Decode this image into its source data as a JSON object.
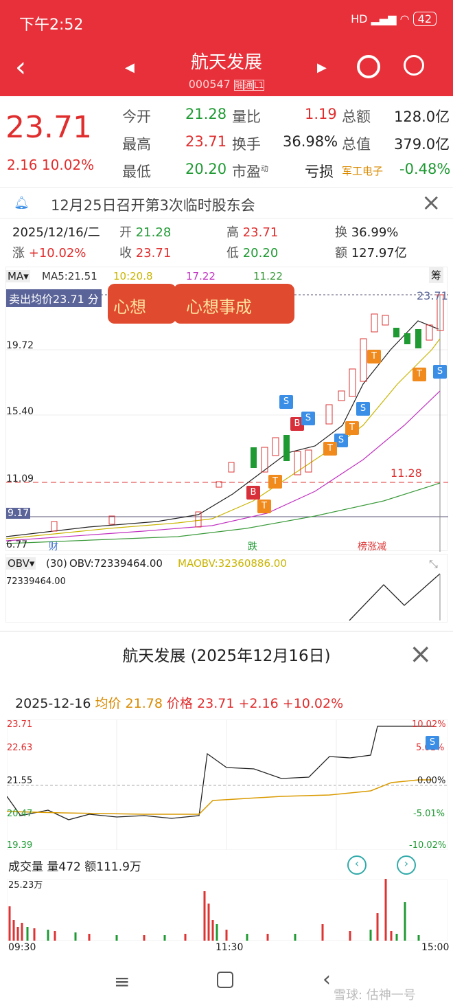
{
  "status": {
    "time": "下午2:52",
    "battery": "42",
    "signal": "HD"
  },
  "nav": {
    "title": "航天发展",
    "code": "000547",
    "tag1": "融",
    "tag2": "通",
    "tag3": "L1"
  },
  "quote": {
    "price": "23.71",
    "change": "2.16",
    "pct": "10.02%",
    "k1": "今开",
    "v1": "21.28",
    "k2": "量比",
    "v2": "1.19",
    "k3": "总额",
    "v3": "128.0亿",
    "k4": "最高",
    "v4": "23.71",
    "k5": "换手",
    "v5": "36.98%",
    "k6": "总值",
    "v6": "379.0亿",
    "k7": "最低",
    "v7": "20.20",
    "k8": "市盈",
    "k8sup": "动",
    "v8": "亏损",
    "k9": "军工电子",
    "v9": "-0.48%"
  },
  "notice": "12月25日召开第3次临时股东会",
  "day": {
    "date": "2025/12/16/二",
    "open_k": "开",
    "open": "21.28",
    "high_k": "高",
    "high": "23.71",
    "turn_k": "换",
    "turn": "36.99%",
    "chg_k": "涨",
    "chg": "+10.02%",
    "close_k": "收",
    "close": "23.71",
    "low_k": "低",
    "low": "20.20",
    "amt_k": "额",
    "amt": "127.97亿"
  },
  "kchart": {
    "ma_sel": "MA",
    "ma5": "MA5:21.51",
    "ma10": "10:20.8",
    "ma20": "17.22",
    "ma60": "11.22",
    "sell_avg": "卖出均价23.71 分",
    "fuquan": "筹",
    "y1": "23.71",
    "y2": "19.72",
    "y3": "15.40",
    "y4": "11.09",
    "y5": "9.17",
    "y6": "6.77",
    "line_label": "11.28",
    "banner1": "心想",
    "banner2": "心想事成",
    "ev1": "财",
    "ev2": "跌",
    "ev3": "榜涨减"
  },
  "obv": {
    "sel": "OBV",
    "period": "(30)",
    "obv": "OBV:72339464.00",
    "maobv": "MAOBV:32360886.00",
    "ylab": "72339464.00"
  },
  "intraday": {
    "title": "航天发展 (2025年12月16日)",
    "date": "2025-12-16",
    "avg_k": "均价",
    "avg": "21.78",
    "price_k": "价格",
    "price": "23.71",
    "chg": "+2.16",
    "pct": "+10.02%",
    "y1": "23.71",
    "y2": "22.63",
    "y3": "21.55",
    "y4": "20.47",
    "y5": "19.39",
    "p1": "10.02%",
    "p2": "5.01%",
    "p3": "0.00%",
    "p4": "-5.01%",
    "p5": "-10.02%",
    "vol_k": "成交量",
    "vol": "量472",
    "amt": "额111.9万",
    "vmax": "25.23万",
    "t1": "09:30",
    "t2": "11:30",
    "t3": "15:00"
  },
  "footer": {
    "watermark": "雪球: 估神一号"
  },
  "colors": {
    "red": "#e8303a",
    "up": "#e02d2d",
    "down": "#1f9a33"
  }
}
